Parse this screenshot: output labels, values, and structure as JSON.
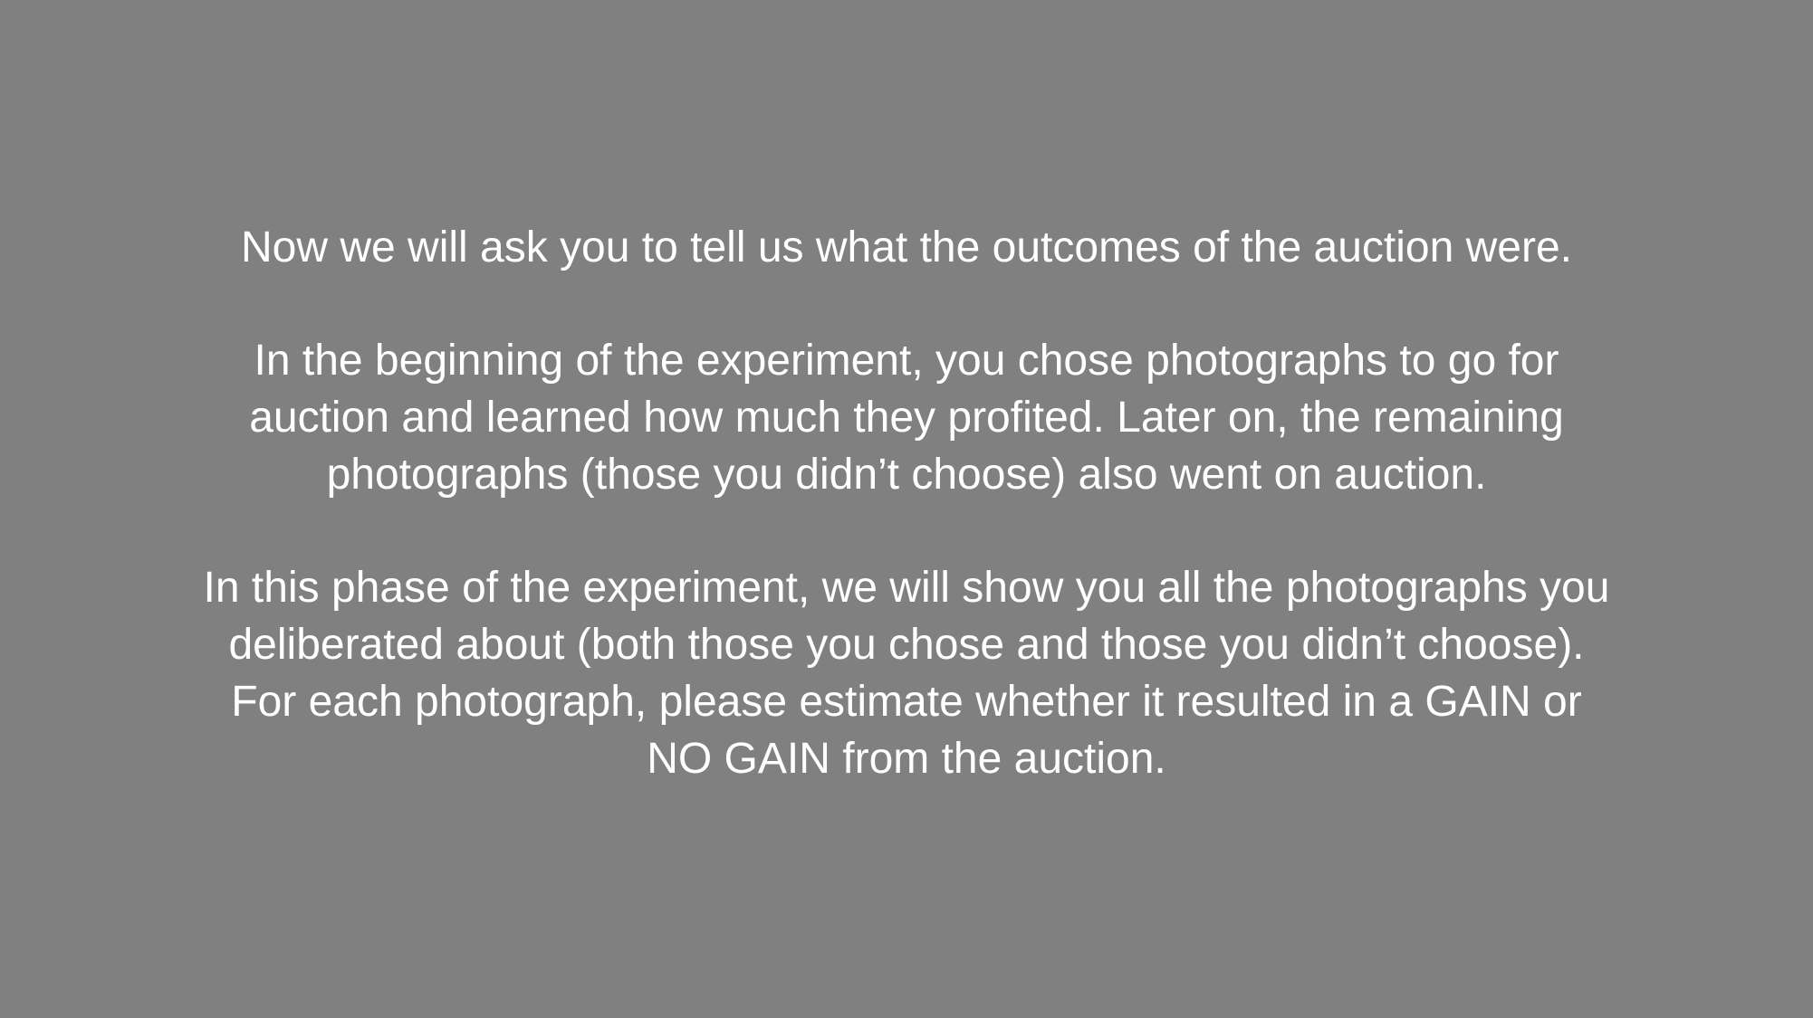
{
  "theme": {
    "background": "#808080",
    "text_color": "#ffffff"
  },
  "instructions": {
    "paragraphs": [
      {
        "lines": [
          "Now we will ask you to tell us what the outcomes of the auction were."
        ]
      },
      {
        "lines": [
          "In the beginning of the experiment, you chose photographs to go for",
          "auction and learned how much they profited. Later on, the remaining",
          "photographs (those you didn’t choose) also went on auction."
        ]
      },
      {
        "lines": [
          "In this phase of the experiment, we will show you all the photographs you",
          "deliberated about (both those you chose and those you didn’t choose).",
          "For each photograph, please estimate whether it resulted in a GAIN or",
          "NO GAIN from the auction."
        ]
      }
    ]
  }
}
